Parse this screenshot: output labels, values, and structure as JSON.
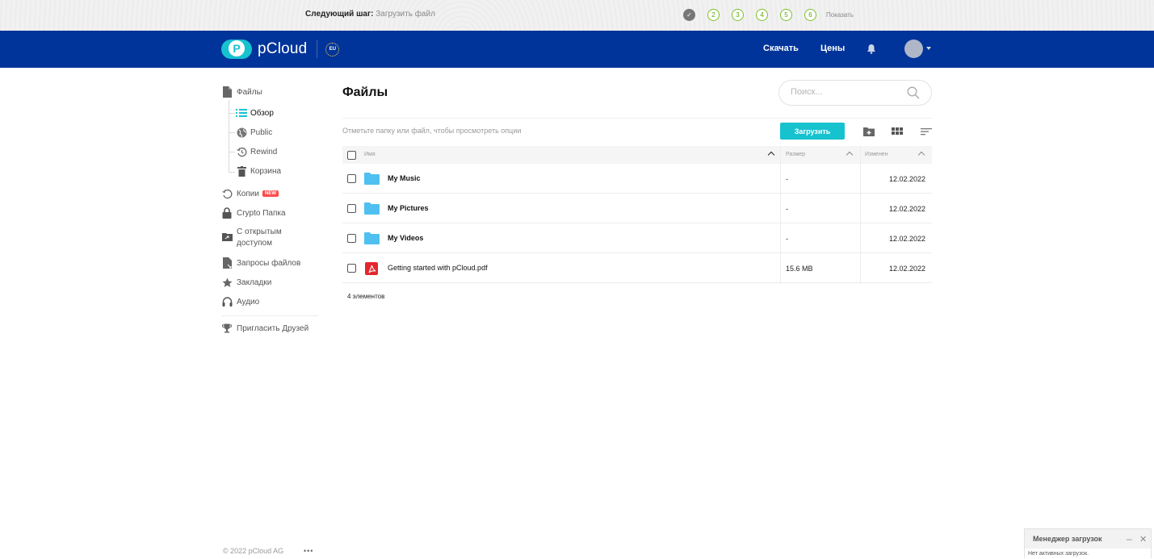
{
  "onboarding": {
    "next_label": "Следующий шаг:",
    "next_value": "Загрузить файл",
    "steps": [
      "✓",
      "2",
      "3",
      "4",
      "5",
      "6"
    ],
    "show_label": "Показать"
  },
  "header": {
    "logo_text": "pCloud",
    "eu_label": "EU",
    "download": "Скачать",
    "prices": "Цены"
  },
  "sidebar": {
    "files": "Файлы",
    "overview": "Обзор",
    "public": "Public",
    "rewind": "Rewind",
    "trash": "Корзина",
    "backups": "Копии",
    "new_badge": "NEW",
    "crypto": "Crypto Папка",
    "shared_line1": "С открытым",
    "shared_line2": "доступом",
    "requests": "Запросы файлов",
    "bookmarks": "Закладки",
    "audio": "Аудио",
    "invite": "Пригласить Друзей",
    "footer": "© 2022 pCloud AG",
    "more": "•••"
  },
  "main": {
    "title": "Файлы",
    "search_placeholder": "Поиск...",
    "hint": "Отметьте папку или файл, чтобы просмотреть опции",
    "upload": "Загрузить",
    "columns": {
      "name": "Имя",
      "size": "Размер",
      "modified": "Изменен"
    },
    "rows": [
      {
        "name": "My Music",
        "size": "-",
        "date": "12.02.2022",
        "type": "folder"
      },
      {
        "name": "My Pictures",
        "size": "-",
        "date": "12.02.2022",
        "type": "folder"
      },
      {
        "name": "My Videos",
        "size": "-",
        "date": "12.02.2022",
        "type": "folder"
      },
      {
        "name": "Getting started with pCloud.pdf",
        "size": "15.6 MB",
        "date": "12.02.2022",
        "type": "pdf"
      }
    ],
    "count": "4 элементов"
  },
  "upload_manager": {
    "title": "Менеджер загрузок",
    "minimize": "–",
    "close": "✕",
    "status": "Нет активных загрузок."
  },
  "colors": {
    "header_bg": "#00349a",
    "accent": "#17c2cf",
    "step_green": "#7cc12a",
    "badge_red": "#ff4a4a",
    "folder_blue": "#4fc0f0"
  }
}
